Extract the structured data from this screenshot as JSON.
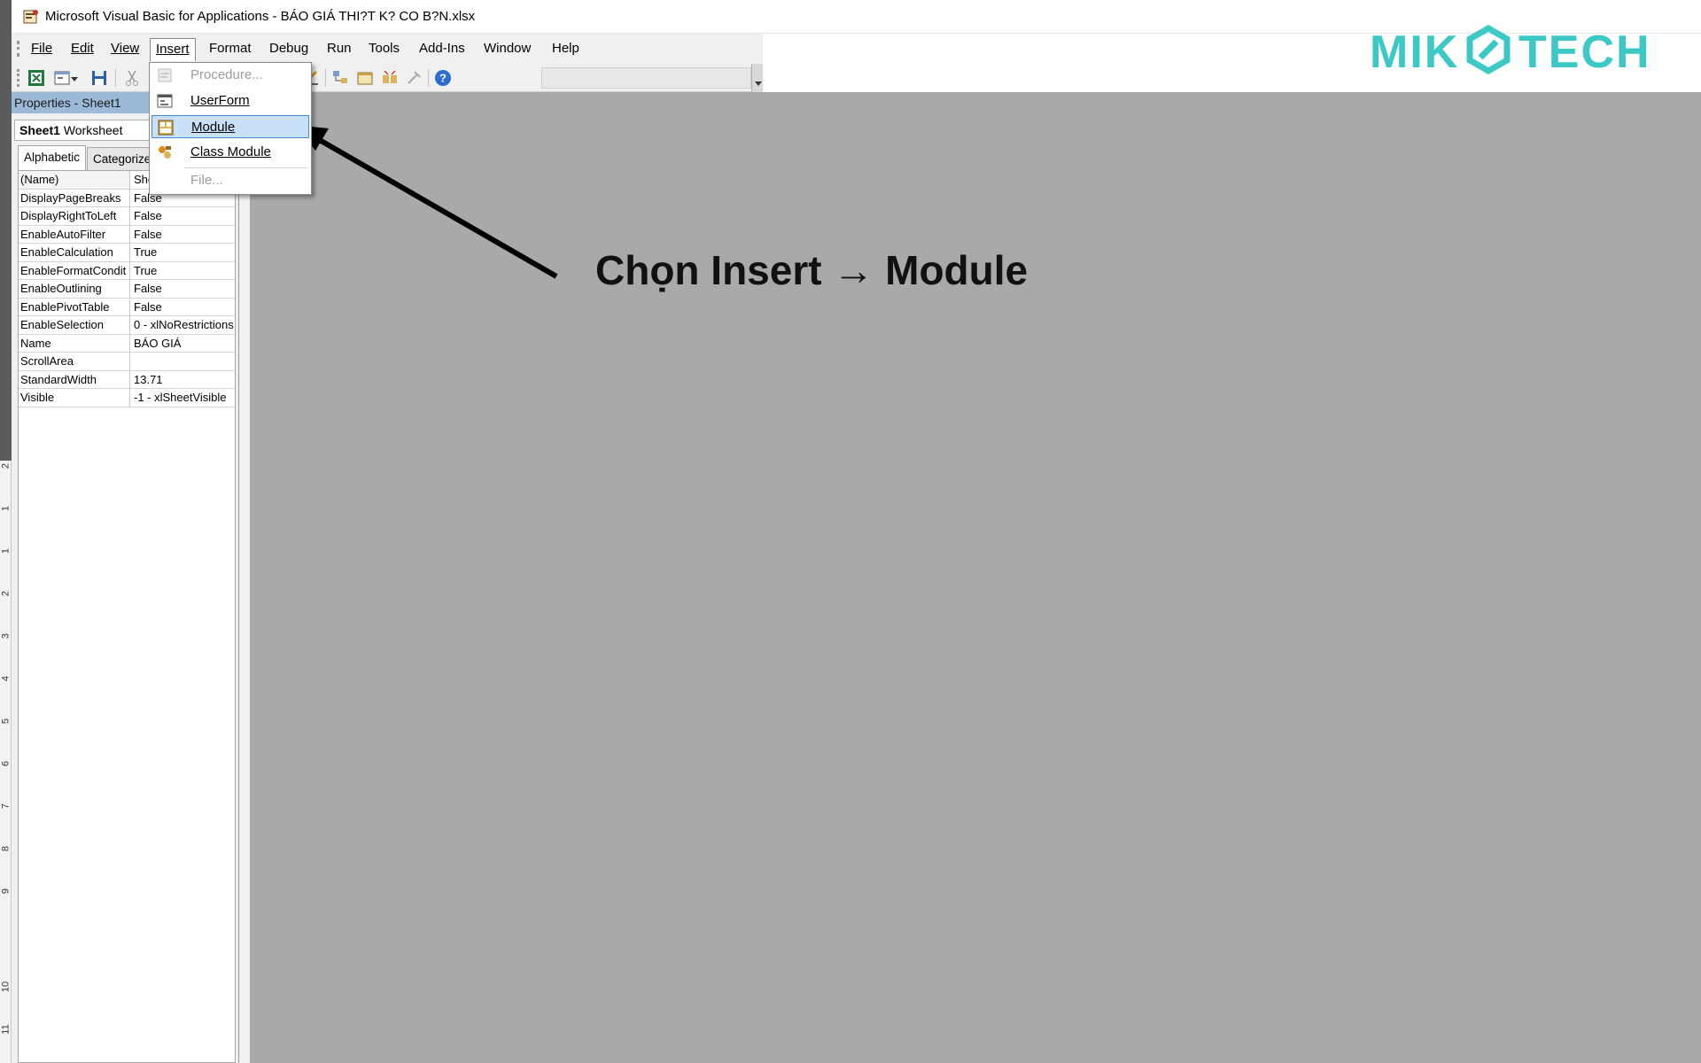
{
  "window": {
    "title": "Microsoft Visual Basic for Applications - BÁO GIÁ THI?T K? CO B?N.xlsx"
  },
  "menubar": {
    "items": [
      {
        "label": "File"
      },
      {
        "label": "Edit"
      },
      {
        "label": "View"
      },
      {
        "label": "Insert"
      },
      {
        "label": "Format"
      },
      {
        "label": "Debug"
      },
      {
        "label": "Run"
      },
      {
        "label": "Tools"
      },
      {
        "label": "Add-Ins"
      },
      {
        "label": "Window"
      },
      {
        "label": "Help"
      }
    ],
    "active": "Insert"
  },
  "insert_menu": {
    "items": [
      {
        "label": "Procedure...",
        "enabled": false,
        "icon": "procedure-icon"
      },
      {
        "label": "UserForm",
        "enabled": true,
        "icon": "userform-icon"
      },
      {
        "label": "Module",
        "enabled": true,
        "highlighted": true,
        "icon": "module-icon"
      },
      {
        "label": "Class Module",
        "enabled": true,
        "icon": "class-module-icon"
      },
      {
        "label": "File...",
        "enabled": false
      }
    ]
  },
  "properties": {
    "title": "Properties - Sheet1",
    "object_name": "Sheet1",
    "object_type": "Worksheet",
    "tabs": [
      "Alphabetic",
      "Categorize"
    ],
    "active_tab": "Alphabetic",
    "rows": [
      {
        "name": "(Name)",
        "value": "She"
      },
      {
        "name": "DisplayPageBreaks",
        "value": "False"
      },
      {
        "name": "DisplayRightToLeft",
        "value": "False"
      },
      {
        "name": "EnableAutoFilter",
        "value": "False"
      },
      {
        "name": "EnableCalculation",
        "value": "True"
      },
      {
        "name": "EnableFormatCondit",
        "value": "True"
      },
      {
        "name": "EnableOutlining",
        "value": "False"
      },
      {
        "name": "EnablePivotTable",
        "value": "False"
      },
      {
        "name": "EnableSelection",
        "value": "0 - xlNoRestrictions"
      },
      {
        "name": "Name",
        "value": "BÁO GIÁ"
      },
      {
        "name": "ScrollArea",
        "value": ""
      },
      {
        "name": "StandardWidth",
        "value": "13.71"
      },
      {
        "name": "Visible",
        "value": "-1 - xlSheetVisible"
      }
    ]
  },
  "annotation": {
    "text": "Chọn Insert → Module"
  },
  "logo": {
    "text": "MIKO TECH",
    "color": "#3cc8c4"
  },
  "ruler": {
    "numbers": [
      "2",
      "1",
      "1",
      "2",
      "3",
      "4",
      "5",
      "6",
      "7",
      "8",
      "9",
      "10",
      "11"
    ]
  },
  "colors": {
    "workspace": "#a9a9a9",
    "menu_highlight": "#c9e0f7",
    "props_title": "#9db9d8"
  }
}
